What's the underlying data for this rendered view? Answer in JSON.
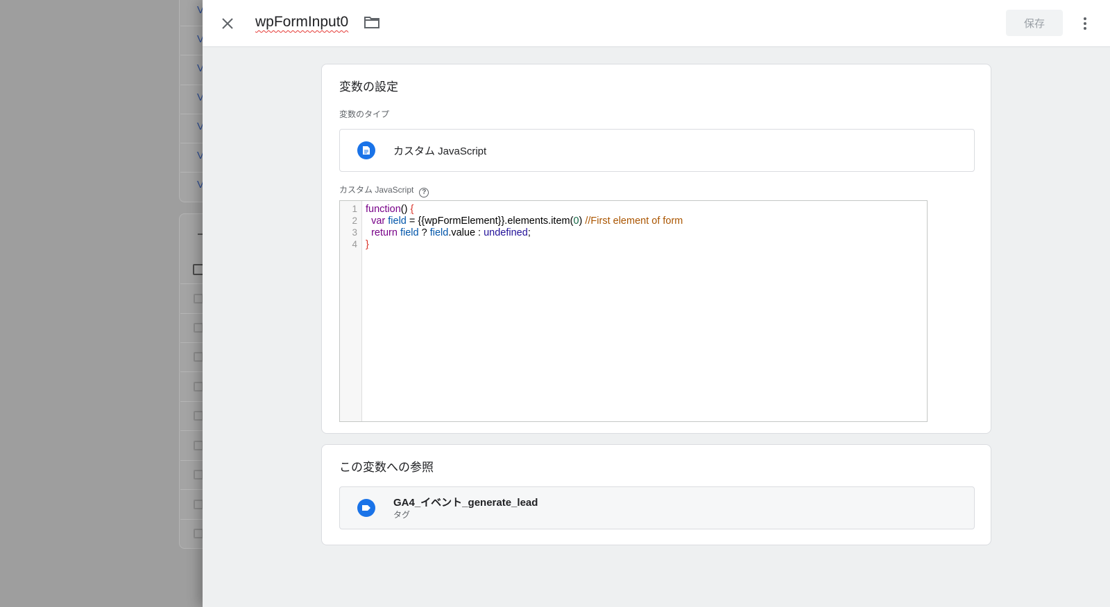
{
  "background": {
    "links": [
      "V",
      "V",
      "V",
      "V",
      "V",
      "V",
      "V"
    ],
    "checkbox_rows": 9
  },
  "header": {
    "title": "wpFormInput0",
    "save_label": "保存"
  },
  "config_card": {
    "heading": "変数の設定",
    "type_label": "変数のタイプ",
    "type_icon": "document-icon",
    "type_name": "カスタム JavaScript",
    "editor_label": "カスタム JavaScript",
    "help_glyph": "?",
    "line_numbers": [
      "1",
      "2",
      "3",
      "4"
    ],
    "code": {
      "l1_kw": "function",
      "l1_paren": "() ",
      "l1_brace": "{",
      "l2_kw": "var",
      "l2_var": "field",
      "l2_mid": " = {{wpFormElement}}.elements.item(",
      "l2_num": "0",
      "l2_close": ") ",
      "l2_comment": "//First element of form",
      "l3_kw": "return",
      "l3_var1": "field",
      "l3_q": " ? ",
      "l3_var2": "field",
      "l3_mid": ".value : ",
      "l3_atom": "undefined",
      "l3_end": ";",
      "l4_brace": "}"
    }
  },
  "references_card": {
    "heading": "この変数への参照",
    "items": [
      {
        "name": "GA4_イベント_generate_lead",
        "kind": "タグ",
        "icon": "tag-icon"
      }
    ]
  },
  "colors": {
    "accent": "#1a73e8",
    "panel_bg": "#eef0f1",
    "overlay": "#9e9e9e"
  }
}
